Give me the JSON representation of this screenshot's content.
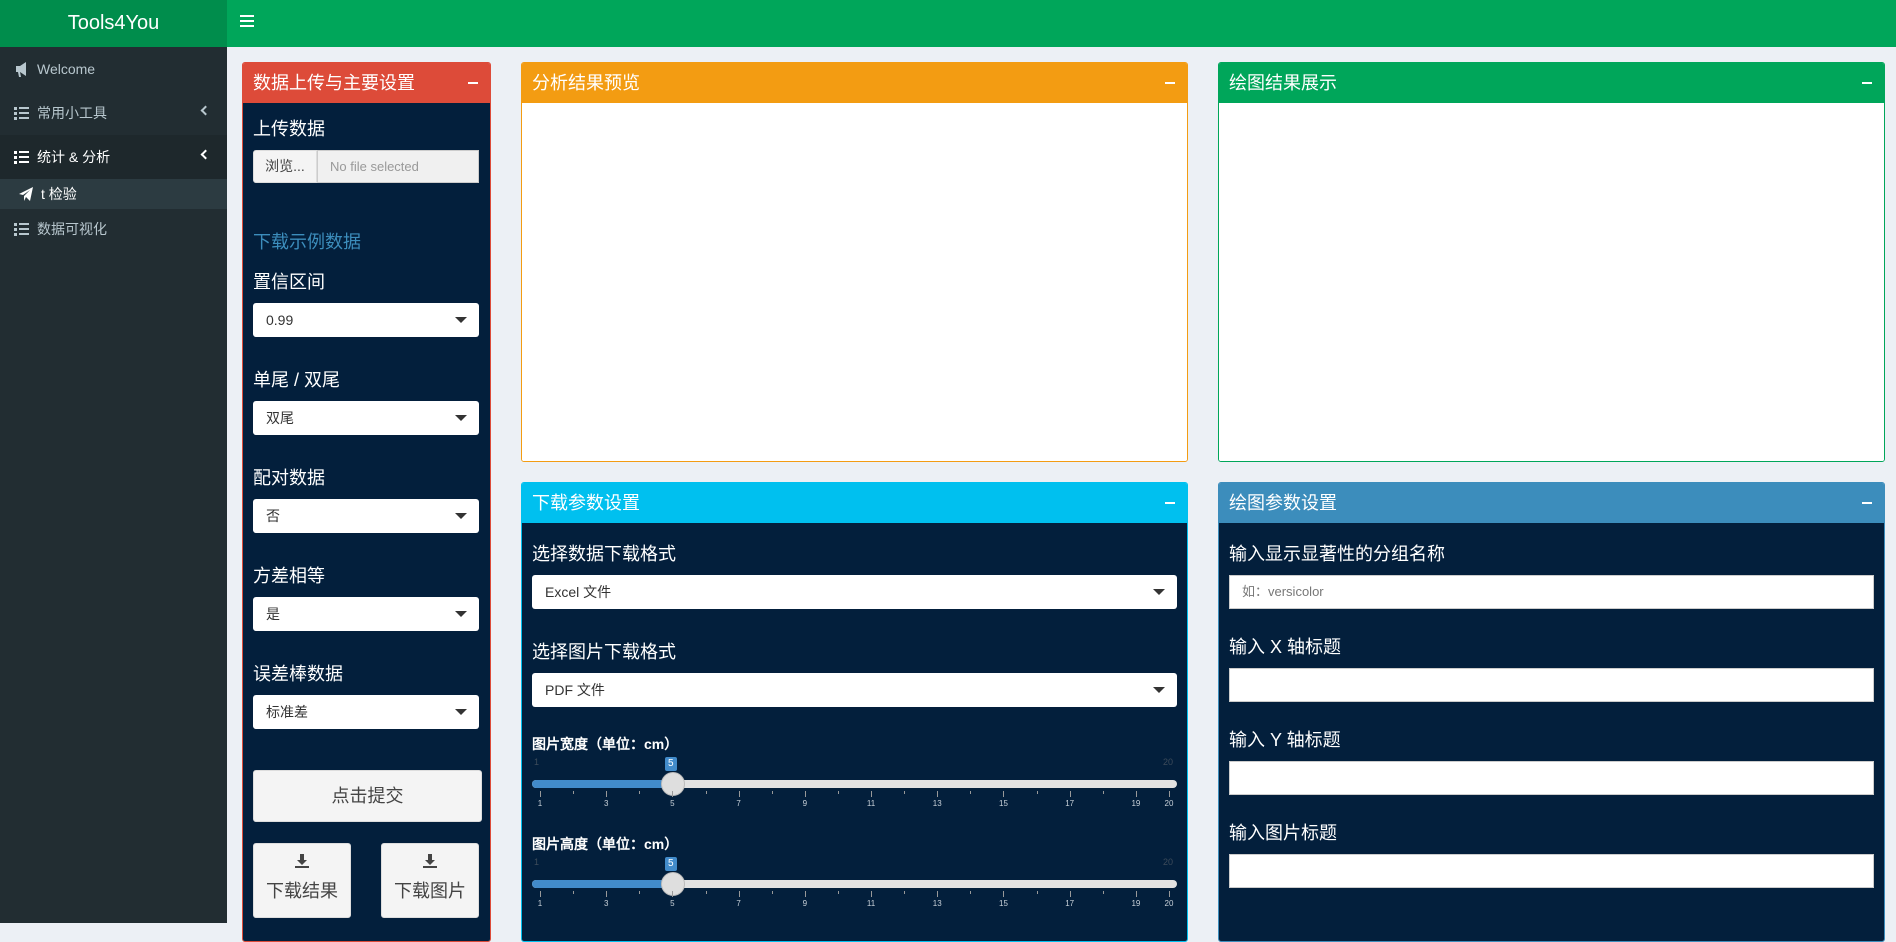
{
  "app": {
    "title": "Tools4You"
  },
  "sidebar": {
    "items": [
      {
        "label": "Welcome",
        "icon": "bullhorn-icon"
      },
      {
        "label": "常用小工具",
        "icon": "list-icon"
      },
      {
        "label": "统计 & 分析",
        "icon": "list-icon"
      },
      {
        "label": "t 检验",
        "icon": "paper-plane-icon"
      },
      {
        "label": "数据可视化",
        "icon": "list-icon"
      }
    ]
  },
  "upload_box": {
    "title": "数据上传与主要设置",
    "color": "#dd4b39",
    "upload_label": "上传数据",
    "browse_label": "浏览...",
    "file_status": "No file selected",
    "example_link": "下载示例数据",
    "fields": [
      {
        "label": "置信区间",
        "value": "0.99"
      },
      {
        "label": "单尾 / 双尾",
        "value": "双尾"
      },
      {
        "label": "配对数据",
        "value": "否"
      },
      {
        "label": "方差相等",
        "value": "是"
      },
      {
        "label": "误差棒数据",
        "value": "标准差"
      }
    ],
    "submit_label": "点击提交",
    "download_result_label": "下载结果",
    "download_image_label": "下载图片"
  },
  "preview_box": {
    "title": "分析结果预览",
    "color": "#f39c12"
  },
  "plot_box": {
    "title": "绘图结果展示",
    "color": "#00a65a"
  },
  "download_box": {
    "title": "下载参数设置",
    "color": "#00c0ef",
    "data_format_label": "选择数据下载格式",
    "data_format_value": "Excel 文件",
    "image_format_label": "选择图片下载格式",
    "image_format_value": "PDF 文件",
    "width_label": "图片宽度（单位：cm）",
    "width_value": "5",
    "height_label": "图片高度（单位：cm）",
    "height_value": "5",
    "slider_min": "1",
    "slider_max": "20",
    "tick_labels": [
      "1",
      "3",
      "5",
      "7",
      "9",
      "11",
      "13",
      "15",
      "17",
      "19",
      "20"
    ]
  },
  "plot_param_box": {
    "title": "绘图参数设置",
    "color": "#3c8dbc",
    "group_label": "输入显示显著性的分组名称",
    "group_placeholder": "如：versicolor",
    "x_label": "输入 X 轴标题",
    "y_label": "输入 Y 轴标题",
    "title_label": "输入图片标题"
  }
}
